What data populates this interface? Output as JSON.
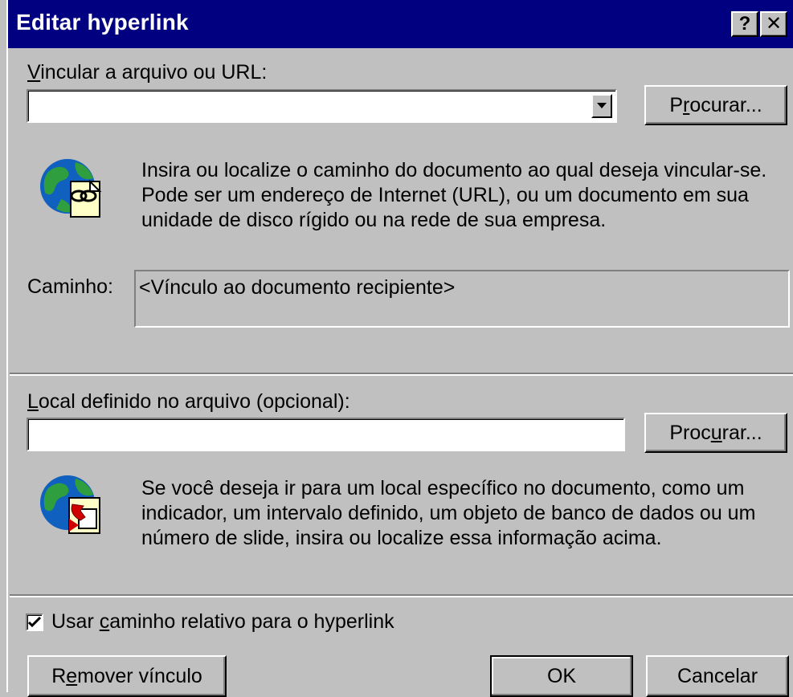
{
  "window": {
    "title": "Editar hyperlink",
    "help_glyph": "?",
    "close_glyph": "✕"
  },
  "url_section": {
    "label_mnemonic": "V",
    "label_rest": "incular a arquivo ou URL:",
    "value": "",
    "browse_pre": "P",
    "browse_mnemonic": "r",
    "browse_post": "ocurar...",
    "description": "Insira ou localize o caminho do documento ao qual deseja vincular-se.  Pode ser um endereço de Internet (URL), ou um documento em sua unidade de disco rígido ou na rede de sua empresa.",
    "icon": "globe-link-document-icon",
    "path_label": "Caminho:",
    "path_value": "<Vínculo ao documento recipiente>"
  },
  "location_section": {
    "label_mnemonic": "L",
    "label_rest": "ocal definido no arquivo (opcional):",
    "value": "",
    "browse_pre": "Proc",
    "browse_mnemonic": "u",
    "browse_post": "rar...",
    "description": "Se você deseja ir para um local específico no documento, como um indicador, um intervalo definido, um objeto de banco de dados ou um número de slide, insira ou localize essa informação acima.",
    "icon": "globe-bookmark-document-icon"
  },
  "relative_path": {
    "checked": true,
    "label_pre": "Usar ",
    "label_mnemonic": "c",
    "label_post": "aminho relativo para o hyperlink"
  },
  "buttons": {
    "remove_pre": "R",
    "remove_mnemonic": "e",
    "remove_post": "mover vínculo",
    "ok": "OK",
    "cancel": "Cancelar"
  },
  "colors": {
    "face": "#c0c0c0",
    "titlebar": "#000080"
  }
}
